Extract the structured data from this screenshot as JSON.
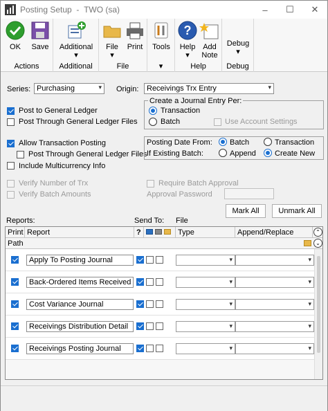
{
  "window": {
    "title": "Posting Setup",
    "company": "TWO (sa)",
    "controls": [
      "–",
      "☐",
      "✕"
    ]
  },
  "ribbon": {
    "groups": [
      {
        "label": "Actions",
        "buttons": [
          {
            "label": "OK",
            "icon": "ok-check-icon"
          },
          {
            "label": "Save",
            "icon": "save-disk-icon"
          }
        ]
      },
      {
        "label": "Additional",
        "buttons": [
          {
            "label": "Additional",
            "icon": "additional-icon"
          }
        ]
      },
      {
        "label": "File",
        "buttons": [
          {
            "label": "File",
            "icon": "folder-icon"
          },
          {
            "label": "Print",
            "icon": "printer-icon"
          }
        ]
      },
      {
        "label": "",
        "buttons": [
          {
            "label": "Tools",
            "icon": "tools-icon"
          }
        ]
      },
      {
        "label": "Help",
        "buttons": [
          {
            "label": "Help",
            "icon": "help-icon"
          },
          {
            "label": "Add Note",
            "icon": "add-note-icon"
          }
        ]
      },
      {
        "label": "Debug",
        "buttons": [
          {
            "label": "Debug",
            "icon": "debug-icon"
          }
        ]
      }
    ],
    "tools_footer": "▾"
  },
  "form": {
    "series_label": "Series:",
    "series_value": "Purchasing",
    "origin_label": "Origin:",
    "origin_value": "Receivings Trx Entry",
    "post_gl": "Post to General Ledger",
    "post_through_gl": "Post Through General Ledger Files",
    "journal_group_title": "Create a Journal Entry Per:",
    "journal_transaction": "Transaction",
    "journal_batch": "Batch",
    "use_account_settings": "Use Account Settings",
    "allow_trx_posting": "Allow Transaction Posting",
    "post_through_gl_2": "Post Through General Ledger Files",
    "include_multicurrency": "Include Multicurrency Info",
    "posting_date_from_label": "Posting Date From:",
    "posting_date_batch": "Batch",
    "posting_date_transaction": "Transaction",
    "if_existing_batch_label": "If Existing Batch:",
    "existing_append": "Append",
    "existing_create_new": "Create New",
    "verify_number_of_trx": "Verify Number of Trx",
    "verify_batch_amounts": "Verify Batch Amounts",
    "require_batch_approval": "Require Batch Approval",
    "approval_password_label": "Approval Password"
  },
  "reports": {
    "reports_label": "Reports:",
    "send_to_label": "Send To:",
    "file_label": "File",
    "mark_all": "Mark All",
    "unmark_all": "Unmark All",
    "columns": {
      "print": "Print",
      "report": "Report",
      "help": "?",
      "type": "Type",
      "append_replace": "Append/Replace",
      "path": "Path"
    },
    "rows": [
      {
        "report": "Apply To Posting Journal",
        "print": true
      },
      {
        "report": "Back-Ordered Items Received",
        "print": true
      },
      {
        "report": "Cost Variance Journal",
        "print": true
      },
      {
        "report": "Receivings Distribution Detail",
        "print": true
      },
      {
        "report": "Receivings Posting Journal",
        "print": true
      }
    ]
  },
  "colors": {
    "accent": "#1a6fd0"
  }
}
